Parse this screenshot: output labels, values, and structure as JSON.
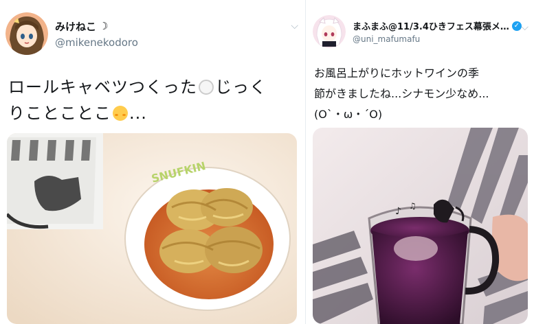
{
  "tweets": [
    {
      "display_name": "みけねこ",
      "name_emoji": "☽",
      "handle": "@mikenekodoro",
      "text_part1": "ロールキャベツつくった",
      "text_part2": "じっく\nりことことこ",
      "text_part3": "...",
      "photo_label": "SNUFKIN",
      "avatar": "avatar-girl-icon",
      "chevron": "chevron-down-icon"
    },
    {
      "display_name": "まふまふ@11/3.4ひきフェス幕張メ…",
      "verified_icon": "verified-badge-icon",
      "handle": "@uni_mafumafu",
      "text": "お風呂上がりにホットワインの季\n節がきましたね...シナモン少なめ...\n(O`・ω・´O)",
      "avatar": "avatar-white-hair-icon",
      "chevron": "chevron-down-icon"
    }
  ],
  "colors": {
    "name": "#14171a",
    "handle": "#657786",
    "verified": "#1da1f2",
    "wine": "#4a1a4a",
    "soup": "#d2691e"
  }
}
